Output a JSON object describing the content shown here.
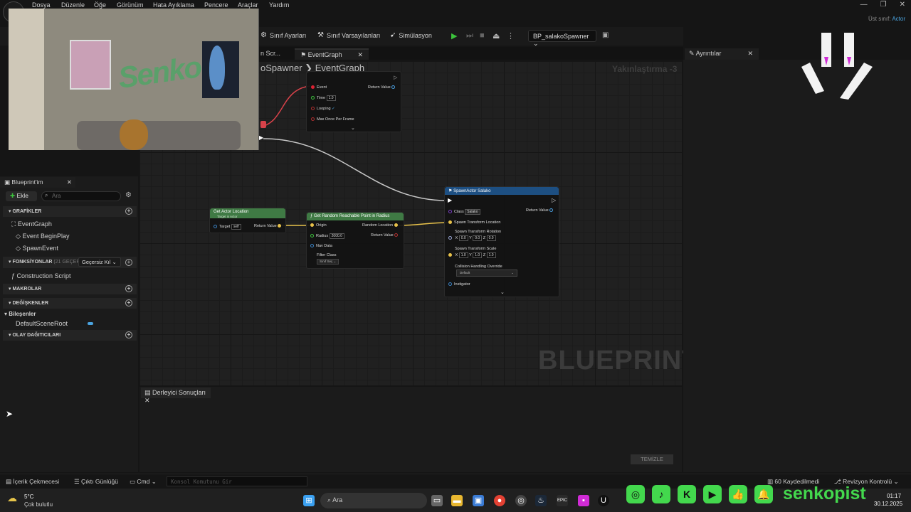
{
  "menu": {
    "items": [
      "Dosya",
      "Düzenle",
      "Öğe",
      "Görünüm",
      "Hata Ayıklama",
      "Pencere",
      "Araçlar",
      "Yardım"
    ]
  },
  "window": {
    "parent_class_label": "Üst sınıf:",
    "parent_class_value": "Actor"
  },
  "toolbar": {
    "class_settings": "Sınıf Ayarları",
    "class_defaults": "Sınıf Varsayılanları",
    "simulation": "Simülasyon",
    "blueprint_select": "BP_salakoSpawner"
  },
  "tabs": {
    "partial_tab": "n Scr...",
    "event_graph": "EventGraph",
    "details": "Ayrıntılar"
  },
  "graph": {
    "breadcrumb_prefix": "oSpawner",
    "breadcrumb_sep": "❯",
    "breadcrumb_current": "EventGraph",
    "zoom": "Yakınlaştırma -3",
    "watermark": "BLUEPRINT"
  },
  "nodes": {
    "timer": {
      "event": "Event",
      "return_value": "Return Value",
      "time_label": "Time",
      "time_value": "1.0",
      "looping": "Looping",
      "max_once": "Max Once Per Frame"
    },
    "get_actor_location": {
      "title": "Get Actor Location",
      "subtitle": "Target is Actor",
      "target": "Target",
      "target_value": "self",
      "return_value": "Return Value"
    },
    "random_point": {
      "title": "Get Random Reachable Point in Radius",
      "origin": "Origin",
      "random_location": "Random Location",
      "radius": "Radius",
      "radius_value": "2000.0",
      "return_value": "Return Value",
      "nav_data": "Nav Data",
      "filter_class": "Filter Class",
      "filter_value": "Sınıf Seç"
    },
    "spawn_actor": {
      "title": "SpawnActor Salako",
      "class_label": "Class",
      "class_value": "Salako",
      "return_value": "Return Value",
      "spawn_location": "Spawn Transform Location",
      "spawn_rotation": "Spawn Transform Rotation",
      "rotation_values": [
        "0.0",
        "0.0",
        "0.0"
      ],
      "spawn_scale": "Spawn Transform Scale",
      "scale_values": [
        "1.0",
        "1.0",
        "1.0"
      ],
      "collision": "Collision Handling Override",
      "collision_value": "Default",
      "instigator": "Instigator",
      "axis_labels": [
        "X",
        "Y",
        "Z"
      ]
    }
  },
  "left_panel": {
    "tab": "Blueprint'im",
    "add_label": "Ekle",
    "search_placeholder": "Ara",
    "graphs_section": "GRAFİKLER",
    "event_graph": "EventGraph",
    "event_begin_play": "Event BeginPlay",
    "spawn_event": "SpawnEvent",
    "functions_section": "FONKSİYONLAR",
    "functions_count": "(21 GEÇERSİZ",
    "override_label": "Geçersiz Kıl",
    "construction_script": "Construction Script",
    "macros_section": "MAKROLAR",
    "variables_section": "DEĞİŞKENLER",
    "components_label": "Bileşenler",
    "default_scene_root": "DefaultSceneRoot",
    "dispatchers_section": "OLAY DAĞITICILARI"
  },
  "compiler": {
    "tab": "Derleyici Sonuçları",
    "clear_button": "TEMİZLE"
  },
  "statusbar": {
    "content_drawer": "İçerik Çekmecesi",
    "output_log": "Çıktı Günlüğü",
    "cmd": "Cmd",
    "console_placeholder": "Konsol Komutunu Gir",
    "unsaved": "60 Kaydedilmedi",
    "revision": "Revizyon Kontrolü"
  },
  "taskbar": {
    "temp": "5°C",
    "weather": "Çok bulutlu",
    "search": "Ara",
    "time": "01:17",
    "date": "30.12.2025"
  },
  "overlay": {
    "webcam_art_text": "Senko",
    "social_name": "senkopist"
  },
  "colors": {
    "accent": "#4aa3df",
    "social_green": "#43d84d",
    "exec_wire": "#c8c8c8",
    "red_wire": "#d8424a",
    "yellow_pin": "#e8c24a"
  }
}
